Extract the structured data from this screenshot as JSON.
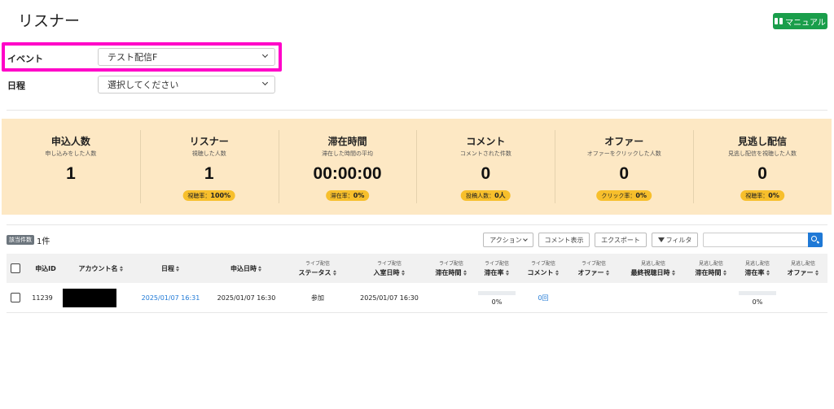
{
  "header": {
    "title": "リスナー",
    "manual_label": "マニュアル"
  },
  "filters": {
    "event_label": "イベント",
    "event_value": "テスト配信F",
    "schedule_label": "日程",
    "schedule_value": "選択してください"
  },
  "stats": [
    {
      "label": "申込人数",
      "sub": "申し込みをした人数",
      "value": "1",
      "badge_label": "",
      "badge_value": ""
    },
    {
      "label": "リスナー",
      "sub": "視聴した人数",
      "value": "1",
      "badge_label": "視聴率：",
      "badge_value": "100%"
    },
    {
      "label": "滞在時間",
      "sub": "滞在した時間の平均",
      "value": "00:00:00",
      "badge_label": "滞在率：",
      "badge_value": "0%"
    },
    {
      "label": "コメント",
      "sub": "コメントされた件数",
      "value": "0",
      "badge_label": "投稿人数：",
      "badge_value": "0人"
    },
    {
      "label": "オファー",
      "sub": "オファーをクリックした人数",
      "value": "0",
      "badge_label": "クリック率：",
      "badge_value": "0%"
    },
    {
      "label": "見逃し配信",
      "sub": "見逃し配信を視聴した人数",
      "value": "0",
      "badge_label": "視聴率：",
      "badge_value": "0%"
    }
  ],
  "toolbar": {
    "count_badge": "該当件数",
    "count_text": "1件",
    "action_label": "アクション",
    "comment_label": "コメント表示",
    "export_label": "エクスポート",
    "filter_label": "フィルタ"
  },
  "table": {
    "columns": [
      {
        "pre": "",
        "label": "申込ID"
      },
      {
        "pre": "",
        "label": "アカウント名"
      },
      {
        "pre": "",
        "label": "日程"
      },
      {
        "pre": "",
        "label": "申込日時"
      },
      {
        "pre": "ライブ配信",
        "label": "ステータス"
      },
      {
        "pre": "ライブ配信",
        "label": "入室日時"
      },
      {
        "pre": "ライブ配信",
        "label": "滞在時間"
      },
      {
        "pre": "ライブ配信",
        "label": "滞在率"
      },
      {
        "pre": "ライブ配信",
        "label": "コメント"
      },
      {
        "pre": "ライブ配信",
        "label": "オファー"
      },
      {
        "pre": "見逃し配信",
        "label": "最終視聴日時"
      },
      {
        "pre": "見逃し配信",
        "label": "滞在時間"
      },
      {
        "pre": "見逃し配信",
        "label": "滞在率"
      },
      {
        "pre": "見逃し配信",
        "label": "オファー"
      }
    ],
    "rows": [
      {
        "id": "11239",
        "schedule": "2025/01/07 16:31",
        "applied_at": "2025/01/07 16:30",
        "status": "参加",
        "entered_at": "2025/01/07 16:30",
        "live_stay_rate": "0%",
        "live_stay_rate_fraction": 0,
        "comments": "0回",
        "archive_stay_rate": "0%",
        "archive_stay_rate_fraction": 0
      }
    ]
  }
}
